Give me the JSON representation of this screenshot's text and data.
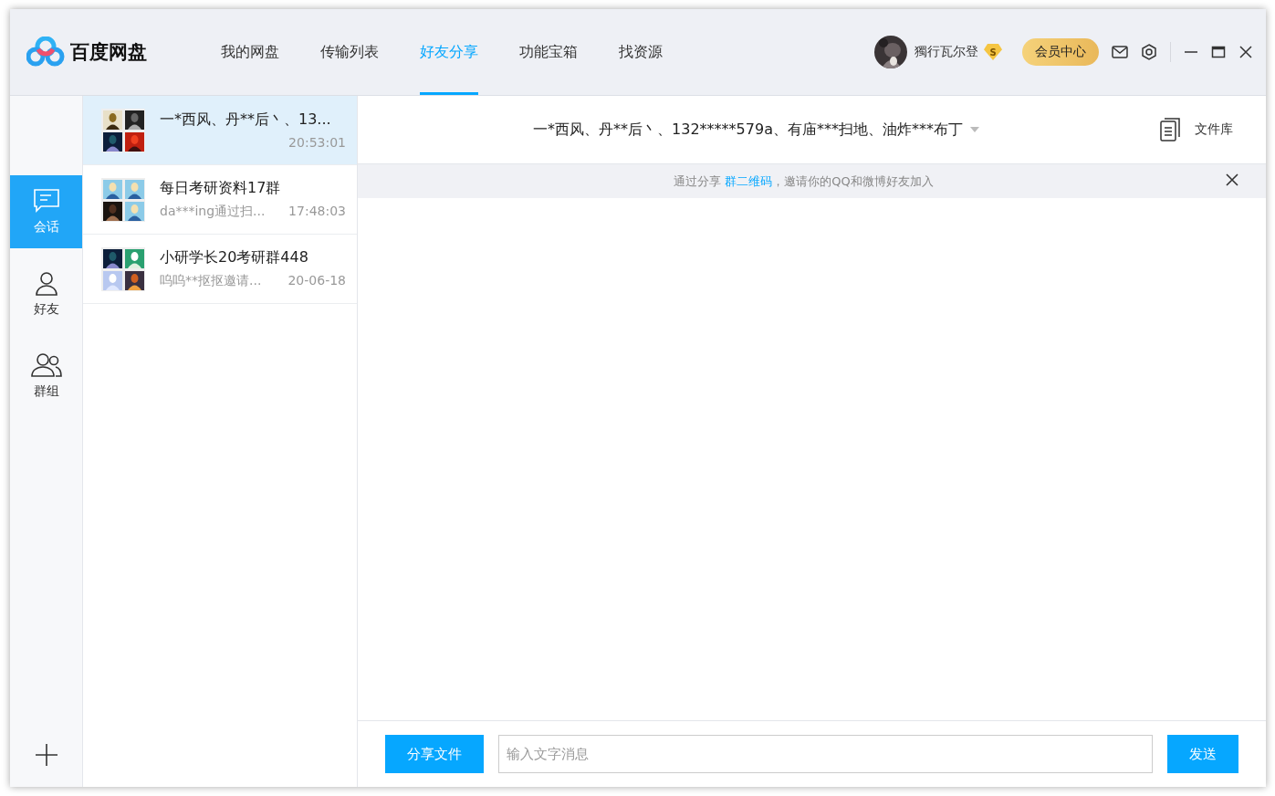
{
  "app": {
    "name": "百度网盘"
  },
  "nav": [
    {
      "label": "我的网盘",
      "selected": false
    },
    {
      "label": "传输列表",
      "selected": false
    },
    {
      "label": "好友分享",
      "selected": true
    },
    {
      "label": "功能宝箱",
      "selected": false
    },
    {
      "label": "找资源",
      "selected": false
    }
  ],
  "user": {
    "name": "獨行瓦尔登",
    "badge": "S"
  },
  "vip_button": "会员中心",
  "sidebar": {
    "items": [
      {
        "label": "会话",
        "kind": "chat",
        "selected": true
      },
      {
        "label": "好友",
        "kind": "person",
        "selected": false
      },
      {
        "label": "群组",
        "kind": "group",
        "selected": false
      }
    ]
  },
  "conversations": [
    {
      "title": "一*西风、丹**后丶、13...",
      "time": "20:53:01",
      "selected": true
    },
    {
      "title": "每日考研资料17群",
      "preview": "da***ing通过扫...",
      "time": "17:48:03",
      "selected": false
    },
    {
      "title": "小研学长20考研群448",
      "preview": "呜呜**抠抠邀请...",
      "time": "20-06-18",
      "selected": false
    }
  ],
  "chat": {
    "title": "一*西风、丹**后丶、132*****579a、有庙***扫地、油炸***布丁",
    "files_button": "文件库",
    "notice": {
      "before": "通过分享 ",
      "link": "群二维码",
      "after": "，邀请你的QQ和微博好友加入"
    },
    "share_button": "分享文件",
    "input": {
      "placeholder": "输入文字消息"
    },
    "send_button": "发送"
  }
}
